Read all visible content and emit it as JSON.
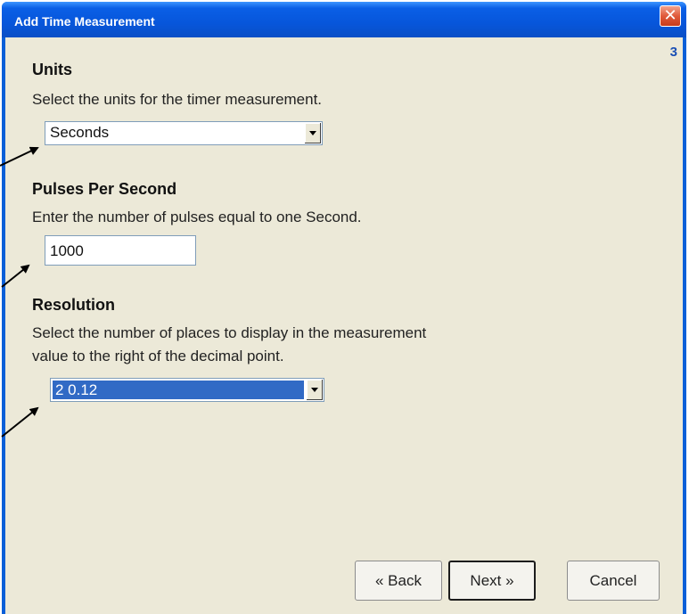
{
  "window": {
    "title": "Add Time Measurement",
    "page_number": "3",
    "close_glyph": "✕"
  },
  "units": {
    "heading": "Units",
    "description": "Select the units for the timer measurement.",
    "selected": "Seconds"
  },
  "pulses": {
    "heading": "Pulses Per Second",
    "description": "Enter the number of pulses equal to one Second.",
    "value": "1000"
  },
  "resolution": {
    "heading": "Resolution",
    "description_line1": "Select the number of places to display in the measurement",
    "description_line2": "value to the right of the decimal point.",
    "selected": "2  0.12"
  },
  "buttons": {
    "back": "« Back",
    "next": "Next »",
    "cancel": "Cancel"
  },
  "colors": {
    "titlebar": "#0a5fd8",
    "client": "#ece9d8",
    "selection": "#316ac5",
    "page_number": "#1a4fb5"
  }
}
